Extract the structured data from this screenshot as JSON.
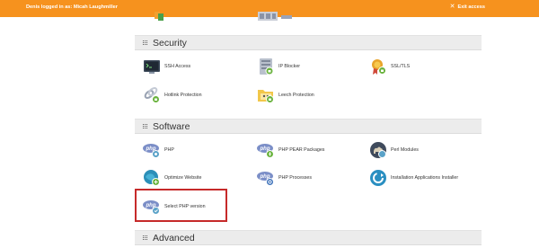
{
  "topbar": {
    "message": "Denis logged in as: Micah Laughmiller",
    "exit_label": "Exit access"
  },
  "sections": {
    "security": {
      "title": "Security",
      "items": [
        {
          "label": "SSH Access",
          "icon": "ssh-terminal-icon"
        },
        {
          "label": "IP Blocker",
          "icon": "ip-blocker-icon"
        },
        {
          "label": "SSL/TLS",
          "icon": "ssl-certificate-icon"
        },
        {
          "label": "Hotlink Protection",
          "icon": "hotlink-protection-icon"
        },
        {
          "label": "Leech Protection",
          "icon": "leech-protection-icon"
        }
      ]
    },
    "software": {
      "title": "Software",
      "items": [
        {
          "label": "PHP",
          "icon": "php-icon"
        },
        {
          "label": "PHP PEAR Packages",
          "icon": "php-pear-icon"
        },
        {
          "label": "Perl Modules",
          "icon": "perl-camel-icon"
        },
        {
          "label": "Optimize Website",
          "icon": "optimize-website-icon"
        },
        {
          "label": "PHP Processes",
          "icon": "php-processes-icon"
        },
        {
          "label": "Installation Applications Installer",
          "icon": "installer-icon"
        },
        {
          "label": "Select PHP version",
          "icon": "select-php-version-icon"
        }
      ]
    },
    "advanced": {
      "title": "Advanced"
    }
  },
  "colors": {
    "topbar": "#f6921e",
    "section_header": "#ececec",
    "highlight_box": "#c62a2a",
    "php_blue": "#7b8ec7",
    "success_green": "#6ab33e"
  }
}
